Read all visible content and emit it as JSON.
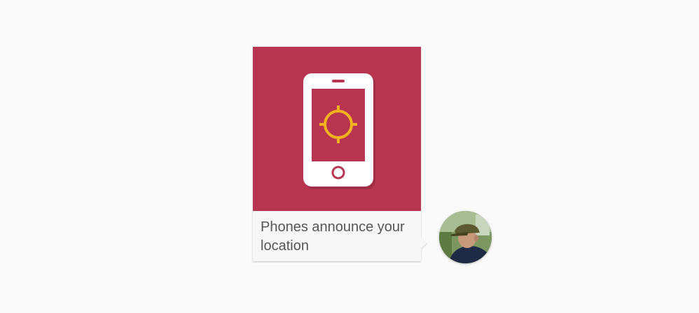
{
  "message": {
    "text": "Phones announce your location"
  },
  "icons": {
    "media": "phone-location-icon",
    "avatar": "user-avatar"
  },
  "colors": {
    "media_background": "#b83552",
    "phone_body": "#ffffff",
    "crosshair": "#f2b21b",
    "caption_background": "#f7f7f7",
    "caption_text": "#555555",
    "page_background": "#fafafa"
  }
}
